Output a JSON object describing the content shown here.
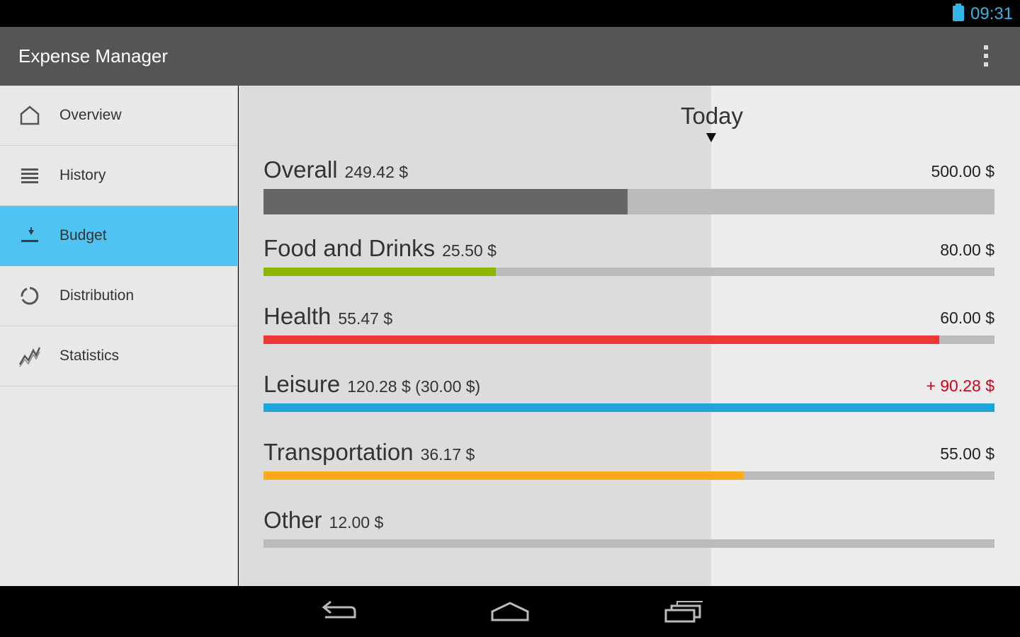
{
  "status_bar": {
    "time": "09:31",
    "icons": [
      "battery-icon"
    ]
  },
  "app": {
    "title": "Expense Manager",
    "menu_icon": "overflow-menu-icon"
  },
  "sidebar": {
    "items": [
      {
        "label": "Overview",
        "icon": "home-icon",
        "active": false
      },
      {
        "label": "History",
        "icon": "list-icon",
        "active": false
      },
      {
        "label": "Budget",
        "icon": "budget-icon",
        "active": true
      },
      {
        "label": "Distribution",
        "icon": "distribution-icon",
        "active": false
      },
      {
        "label": "Statistics",
        "icon": "statistics-icon",
        "active": false
      }
    ]
  },
  "budget": {
    "today_label": "Today",
    "rows": [
      {
        "name": "Overall",
        "spent": "249.42 $",
        "limit": "500.00 $",
        "progress": 0.498,
        "color": "#666666",
        "over": false
      },
      {
        "name": "Food and Drinks",
        "spent": "25.50 $",
        "limit": "80.00 $",
        "progress": 0.318,
        "color": "#8ab800",
        "over": false
      },
      {
        "name": "Health",
        "spent": "55.47 $",
        "limit": "60.00 $",
        "progress": 0.924,
        "color": "#f03737",
        "over": false
      },
      {
        "name": "Leisure",
        "spent": "120.28 $ (30.00 $)",
        "limit": "+ 90.28 $",
        "progress": 1.0,
        "color": "#1da5d9",
        "over": true
      },
      {
        "name": "Transportation",
        "spent": "36.17 $",
        "limit": "55.00 $",
        "progress": 0.657,
        "color": "#ffaa1a",
        "over": false
      },
      {
        "name": "Other",
        "spent": "12.00 $",
        "limit": "",
        "progress": 0,
        "color": "#bbbbbb",
        "over": false
      }
    ]
  },
  "system_nav": {
    "buttons": [
      "back-icon",
      "home-icon",
      "recent-apps-icon"
    ]
  }
}
